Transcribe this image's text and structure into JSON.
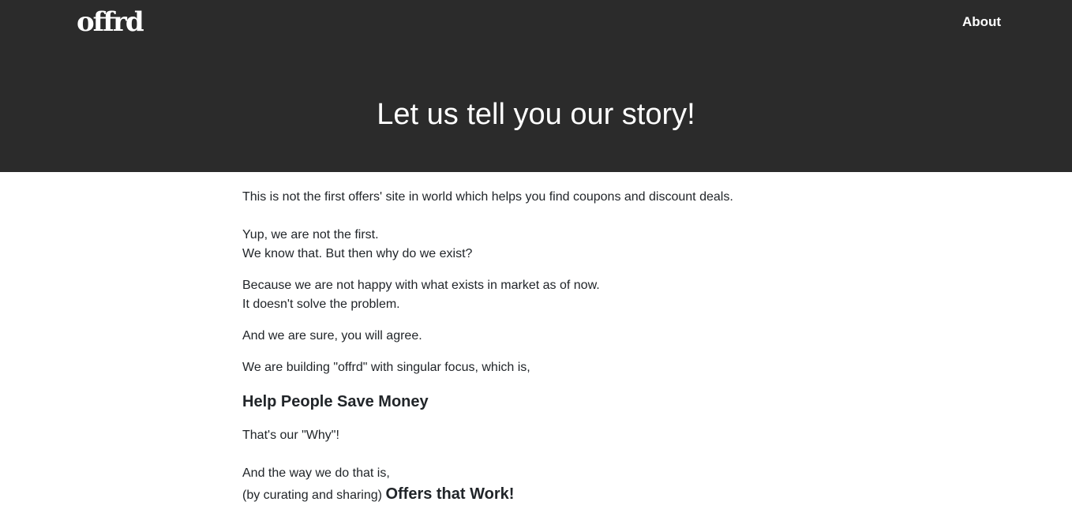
{
  "header": {
    "logo": "offrd",
    "nav_about": "About",
    "hero_title": "Let us tell you our story!"
  },
  "content": {
    "p1": "This is not the first offers' site in world which helps you find coupons and discount deals.",
    "p2_line1": "Yup, we are not the first.",
    "p2_line2": "We know that. But then why do we exist?",
    "p3_line1": "Because we are not happy with what exists in market as of now.",
    "p3_line2": "It doesn't solve the problem.",
    "p4": "And we are sure, you will agree.",
    "p5": "We are building \"offrd\" with singular focus, which is,",
    "heading_money": "Help People Save Money",
    "p6": "That's our \"Why\"!",
    "p7": "And the way we do that is,",
    "p8_prefix": "(by curating and sharing)",
    "p8_strong": "Offers that Work!"
  },
  "colors": {
    "header_bg": "#2b2b2b",
    "header_text": "#ffffff",
    "body_text": "#212529",
    "page_bg": "#ffffff"
  }
}
